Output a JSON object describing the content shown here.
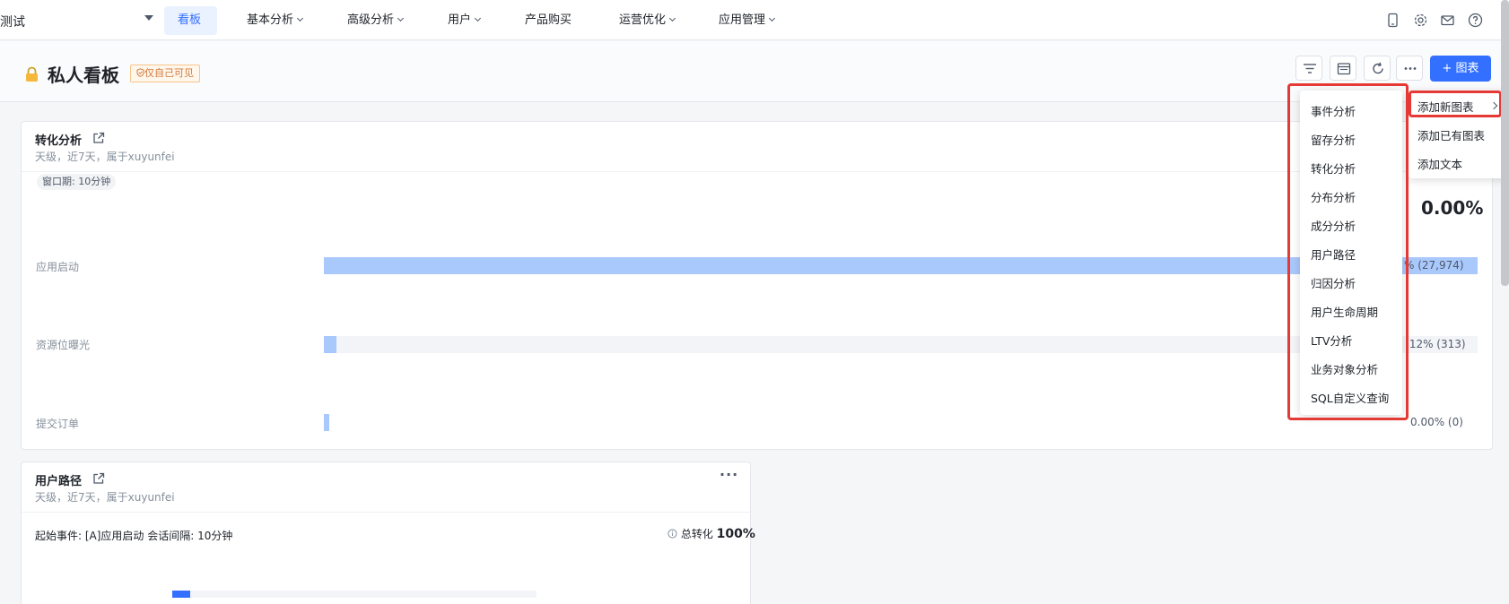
{
  "topnav": {
    "project": "测试",
    "items": [
      {
        "label": "看板",
        "active": true
      },
      {
        "label": "基本分析",
        "has_dropdown": true
      },
      {
        "label": "高级分析",
        "has_dropdown": true
      },
      {
        "label": "用户",
        "has_dropdown": true
      },
      {
        "label": "产品购买",
        "has_dropdown": false
      },
      {
        "label": "运营优化",
        "has_dropdown": true
      },
      {
        "label": "应用管理",
        "has_dropdown": true
      }
    ],
    "icons": [
      "mobile-icon",
      "settings-icon",
      "mail-icon",
      "help-icon"
    ]
  },
  "header": {
    "title": "私人看板",
    "badge": "仅自己可见",
    "add_chart_label": "+ 图表"
  },
  "funnel_card": {
    "title": "转化分析",
    "subtitle": "天级，近7天，属于xuyunfei",
    "window_tag": "窗口期: 10分钟",
    "overall_rate": "0.00%",
    "steps": [
      {
        "label": "应用启动",
        "value_text": "% (27,974)",
        "fraction": 1.0
      },
      {
        "label": "资源位曝光",
        "value_text": ".12% (313)",
        "fraction": 0.0112
      },
      {
        "label": "提交订单",
        "value_text": "0.00% (0)",
        "fraction": 0.0
      }
    ]
  },
  "path_card": {
    "title": "用户路径",
    "subtitle": "天级，近7天，属于xuyunfei",
    "start_event": "起始事件: [A]应用启动  会话间隔: 10分钟",
    "total_label": "总转化",
    "total_value": "100%",
    "more": "···"
  },
  "add_menu": {
    "items": [
      "添加新图表",
      "添加已有图表",
      "添加文本"
    ]
  },
  "chart_type_menu": {
    "items": [
      "事件分析",
      "留存分析",
      "转化分析",
      "分布分析",
      "成分分析",
      "用户路径",
      "归因分析",
      "用户生命周期",
      "LTV分析",
      "业务对象分析",
      "SQL自定义查询"
    ]
  },
  "colors": {
    "accent": "#3370ff",
    "highlight": "#e53935",
    "bar": "#a9c8fb",
    "badge_text": "#d4773a"
  }
}
